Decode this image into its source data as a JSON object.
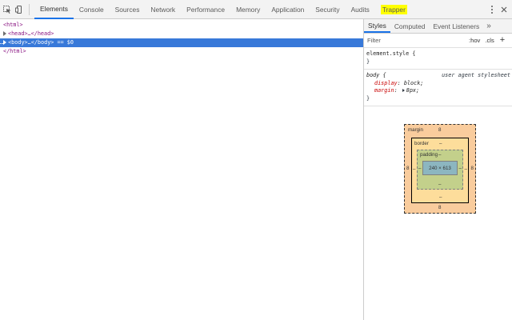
{
  "toolbar": {
    "tabs": [
      "Elements",
      "Console",
      "Sources",
      "Network",
      "Performance",
      "Memory",
      "Application",
      "Security",
      "Audits",
      "Trapper"
    ],
    "active_tab": "Elements",
    "highlighted_tab": "Trapper",
    "icons": [
      "inspect-element-icon",
      "device-toolbar-icon",
      "more-options-icon",
      "close-icon"
    ]
  },
  "dom": {
    "lines": {
      "html_open": "<html>",
      "head": "<head>…</head>",
      "body": "<body>…</body>",
      "body_suffix": " == $0",
      "html_close": "</html>"
    },
    "selected_marker": "…"
  },
  "styles": {
    "subtabs": [
      "Styles",
      "Computed",
      "Event Listeners"
    ],
    "active_subtab": "Styles",
    "more_glyph": "»",
    "filter_placeholder": "Filter",
    "filter_buttons": [
      ":hov",
      ".cls",
      "+"
    ],
    "element_style": {
      "selector": "element.style {",
      "close": "}"
    },
    "body_rule": {
      "selector": "body {",
      "source": "user agent stylesheet",
      "declarations": [
        {
          "name": "display",
          "value": "block;"
        },
        {
          "name": "margin",
          "value": "8px;"
        }
      ],
      "close": "}"
    }
  },
  "box_model": {
    "margin_label": "margin",
    "margin_top": "8",
    "margin_right": "8",
    "margin_bottom": "8",
    "margin_left": "8",
    "border_label": "border",
    "border_top": "–",
    "border_right": "–",
    "border_bottom": "–",
    "border_left": "–",
    "padding_label": "padding",
    "padding_top": "–",
    "padding_right": "–",
    "padding_bottom": "–",
    "padding_left": "–",
    "content": "240 × 613",
    "colors": {
      "margin": "#f9cc9d",
      "border": "#fddd9b",
      "padding": "#c3d08b",
      "content": "#8cb6c0"
    }
  },
  "colors": {
    "selected_row": "#3879d9",
    "tag": "#881280",
    "active_tab_underline": "#1a73e8",
    "trapper_highlight": "#ffff00"
  }
}
